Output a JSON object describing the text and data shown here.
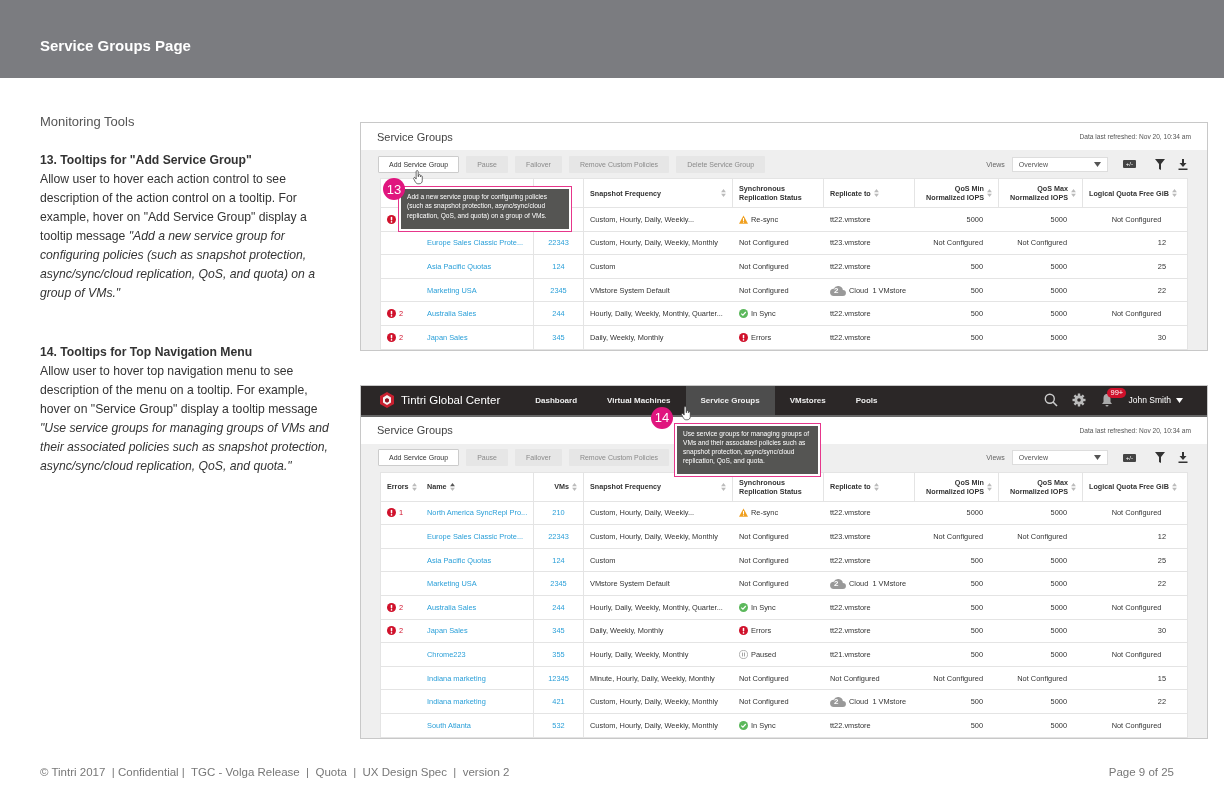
{
  "header": {
    "title": "Service Groups Page"
  },
  "notes": {
    "section": "Monitoring Tools",
    "items": [
      {
        "heading": "13. Tooltips for \"Add Service Group\"",
        "body": "Allow user to hover each action control to see description of the action control on a tooltip. For example, hover on \"Add Service Group\" display a tooltip message *\"Add a new service group for configuring policies (such as snapshot protection, async/sync/cloud replication, QoS, and quota) on a group of VMs.\"*"
      },
      {
        "heading": "14. Tooltips for Top Navigation Menu",
        "body": "Allow user to hover top navigation menu to see description of the menu on a tooltip. For example, hover on \"Service Group\" display a tooltip message *\"Use service groups for managing groups of VMs and their associated policies such as snapshot protection, async/sync/cloud replication, QoS, and quota.\"*"
      }
    ]
  },
  "panels": [
    {
      "title": "Service Groups",
      "refreshed": "Data last refreshed: Nov 20, 10:34 am",
      "actions": [
        {
          "label": "Add Service Group",
          "disabled": false
        },
        {
          "label": "Pause",
          "disabled": true
        },
        {
          "label": "Failover",
          "disabled": true
        },
        {
          "label": "Remove Custom Policies",
          "disabled": true
        },
        {
          "label": "Delete Service Group",
          "disabled": true
        }
      ],
      "views_label": "Views",
      "views_value": "Overview",
      "toggle_label": "+/-",
      "columns": [
        {},
        {},
        {},
        {
          "label": "Snapshot Frequency"
        },
        {
          "label": "Synchronous Replication Status"
        },
        {
          "label": "Replicate to"
        },
        {
          "label": "QoS Min Normalized IOPS"
        },
        {
          "label": "QoS Max Normalized IOPS"
        },
        {
          "label": "Logical Quota Free GiB"
        }
      ],
      "rows": [
        {
          "error": true,
          "snapshot": "Custom, Hourly, Daily, Weekly...",
          "status": {
            "kind": "warning",
            "text": "Re-sync"
          },
          "replicate": {
            "kind": "plain",
            "text": "tt22.vmstore"
          },
          "qos_min": "5000",
          "qos_max": "5000",
          "quota": "Not Configured"
        },
        {
          "error": false,
          "name": "Europe Sales Classic Prote...",
          "vms": "22343",
          "snapshot": "Custom, Hourly, Daily, Weekly, Monthly",
          "status": {
            "kind": "none",
            "text": "Not Configured"
          },
          "replicate": {
            "kind": "plain",
            "text": "tt23.vmstore"
          },
          "qos_min": "Not Configured",
          "qos_max": "Not Configured",
          "quota": "12"
        },
        {
          "error": false,
          "name": "Asia Pacific Quotas",
          "vms": "124",
          "snapshot": "Custom",
          "status": {
            "kind": "none",
            "text": "Not Configured"
          },
          "replicate": {
            "kind": "plain",
            "text": "tt22.vmstore"
          },
          "qos_min": "500",
          "qos_max": "5000",
          "quota": "25"
        },
        {
          "error": false,
          "name": "Marketing USA",
          "vms": "2345",
          "snapshot": "VMstore System Default",
          "status": {
            "kind": "none",
            "text": "Not Configured"
          },
          "replicate": {
            "kind": "cloud",
            "badge": "2",
            "text": "Cloud  1 VMstore"
          },
          "qos_min": "500",
          "qos_max": "5000",
          "quota": "22"
        },
        {
          "error": true,
          "errors": "2",
          "name": "Australia Sales",
          "vms": "244",
          "snapshot": "Hourly, Daily, Weekly, Monthly,  Quarter...",
          "status": {
            "kind": "ok",
            "text": "In Sync"
          },
          "replicate": {
            "kind": "plain",
            "text": "tt22.vmstore"
          },
          "qos_min": "500",
          "qos_max": "5000",
          "quota": "Not Configured"
        },
        {
          "error": true,
          "errors": "2",
          "name": "Japan Sales",
          "vms": "345",
          "snapshot": "Daily, Weekly, Monthly",
          "status": {
            "kind": "error",
            "text": "Errors"
          },
          "replicate": {
            "kind": "plain",
            "text": "tt22.vmstore"
          },
          "qos_min": "500",
          "qos_max": "5000",
          "quota": "30"
        }
      ],
      "callout": {
        "number": "13",
        "text": "Add a new service group for configuring policies (such as snapshot protection, async/sync/cloud replication, QoS, and quota) on a group of VMs."
      }
    },
    {
      "nav": {
        "brand": "Tintri Global Center",
        "items": [
          {
            "label": "Dashboard",
            "selected": false
          },
          {
            "label": "Virtual Machines",
            "selected": false
          },
          {
            "label": "Service Groups",
            "selected": true
          },
          {
            "label": "VMstores",
            "selected": false
          },
          {
            "label": "Pools",
            "selected": false
          }
        ],
        "notifications": "99+",
        "user": "John Smith"
      },
      "title": "Service Groups",
      "refreshed": "Data last refreshed: Nov 20, 10:34 am",
      "actions": [
        {
          "label": "Add Service Group",
          "disabled": false
        },
        {
          "label": "Pause",
          "disabled": true
        },
        {
          "label": "Failover",
          "disabled": true
        },
        {
          "label": "Remove Custom Policies",
          "disabled": true
        }
      ],
      "views_label": "Views",
      "views_value": "Overview",
      "toggle_label": "+/-",
      "columns": [
        {
          "label": "Errors"
        },
        {
          "label": "Name"
        },
        {
          "label": "VMs"
        },
        {
          "label": "Snapshot Frequency"
        },
        {
          "label": "Synchronous Replication Status"
        },
        {
          "label": "Replicate to"
        },
        {
          "label": "QoS Min Normalized IOPS"
        },
        {
          "label": "QoS Max Normalized IOPS"
        },
        {
          "label": "Logical Quota Free GiB"
        }
      ],
      "rows": [
        {
          "error": true,
          "errors": "1",
          "name": "North America SyncRepl Pro...",
          "vms": "210",
          "snapshot": "Custom, Hourly, Daily, Weekly...",
          "status": {
            "kind": "warning",
            "text": "Re-sync"
          },
          "replicate": {
            "kind": "plain",
            "text": "tt22.vmstore"
          },
          "qos_min": "5000",
          "qos_max": "5000",
          "quota": "Not Configured"
        },
        {
          "error": false,
          "name": "Europe Sales Classic Prote...",
          "vms": "22343",
          "snapshot": "Custom, Hourly, Daily, Weekly, Monthly",
          "status": {
            "kind": "none",
            "text": "Not Configured"
          },
          "replicate": {
            "kind": "plain",
            "text": "tt23.vmstore"
          },
          "qos_min": "Not Configured",
          "qos_max": "Not Configured",
          "quota": "12"
        },
        {
          "error": false,
          "name": "Asia Pacific Quotas",
          "vms": "124",
          "snapshot": "Custom",
          "status": {
            "kind": "none",
            "text": "Not Configured"
          },
          "replicate": {
            "kind": "plain",
            "text": "tt22.vmstore"
          },
          "qos_min": "500",
          "qos_max": "5000",
          "quota": "25"
        },
        {
          "error": false,
          "name": "Marketing USA",
          "vms": "2345",
          "snapshot": "VMstore System Default",
          "status": {
            "kind": "none",
            "text": "Not Configured"
          },
          "replicate": {
            "kind": "cloud",
            "badge": "2",
            "text": "Cloud  1 VMstore"
          },
          "qos_min": "500",
          "qos_max": "5000",
          "quota": "22"
        },
        {
          "error": true,
          "errors": "2",
          "name": "Australia Sales",
          "vms": "244",
          "snapshot": "Hourly, Daily, Weekly, Monthly,  Quarter...",
          "status": {
            "kind": "ok",
            "text": "In Sync"
          },
          "replicate": {
            "kind": "plain",
            "text": "tt22.vmstore"
          },
          "qos_min": "500",
          "qos_max": "5000",
          "quota": "Not Configured"
        },
        {
          "error": true,
          "errors": "2",
          "name": "Japan Sales",
          "vms": "345",
          "snapshot": "Daily, Weekly, Monthly",
          "status": {
            "kind": "error",
            "text": "Errors"
          },
          "replicate": {
            "kind": "plain",
            "text": "tt22.vmstore"
          },
          "qos_min": "500",
          "qos_max": "5000",
          "quota": "30"
        },
        {
          "error": false,
          "name": "Chrome223",
          "vms": "355",
          "snapshot": "Hourly, Daily, Weekly, Monthly",
          "status": {
            "kind": "paused",
            "text": "Paused"
          },
          "replicate": {
            "kind": "plain",
            "text": "tt21.vmstore"
          },
          "qos_min": "500",
          "qos_max": "5000",
          "quota": "Not Configured"
        },
        {
          "error": false,
          "name": "Indiana marketing",
          "vms": "12345",
          "snapshot": "Minute, Hourly, Daily, Weekly, Monthly",
          "status": {
            "kind": "none",
            "text": "Not Configured"
          },
          "replicate": {
            "kind": "plain",
            "text": "Not Configured"
          },
          "qos_min": "Not Configured",
          "qos_max": "Not Configured",
          "quota": "15"
        },
        {
          "error": false,
          "name": "Indiana marketing",
          "vms": "421",
          "snapshot": "Custom, Hourly, Daily, Weekly, Monthly",
          "status": {
            "kind": "none",
            "text": "Not Configured"
          },
          "replicate": {
            "kind": "cloud",
            "badge": "2",
            "text": "Cloud  1 VMstore"
          },
          "qos_min": "500",
          "qos_max": "5000",
          "quota": "22"
        },
        {
          "error": false,
          "name": "South Atlanta",
          "vms": "532",
          "snapshot": "Custom, Hourly, Daily, Weekly, Monthly",
          "status": {
            "kind": "ok",
            "text": "In Sync"
          },
          "replicate": {
            "kind": "plain",
            "text": "tt22.vmstore"
          },
          "qos_min": "500",
          "qos_max": "5000",
          "quota": "Not Configured"
        }
      ],
      "callout": {
        "number": "14",
        "text": "Use service groups for managing groups of VMs and their associated policies such as snapshot protection, async/sync/cloud replication, QoS, and quota."
      }
    }
  ],
  "footer": {
    "left": "© Tintri 2017  | Confidential |  TGC - Volga Release  |  Quota  |  UX Design Spec  |  version 2",
    "right": "Page 9 of 25"
  }
}
